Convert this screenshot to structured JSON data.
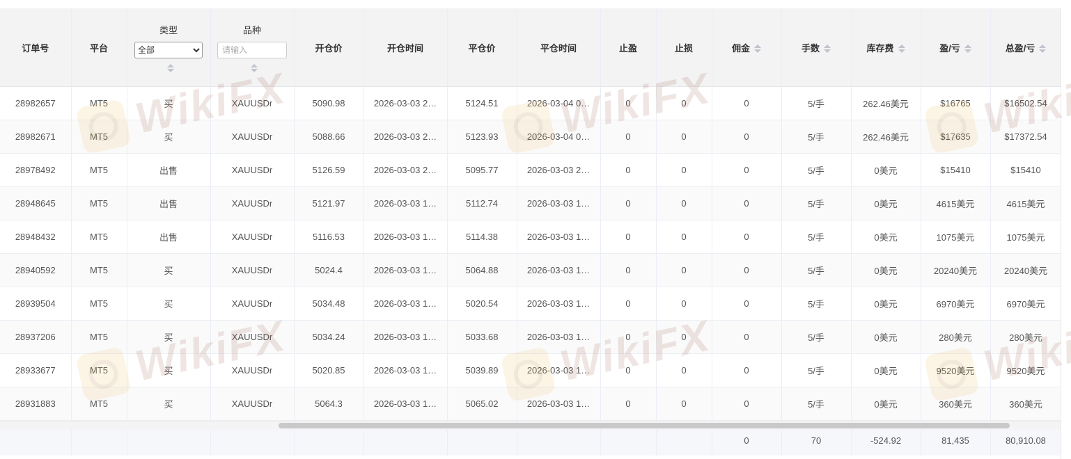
{
  "columns": {
    "order_no": "订单号",
    "platform": "平台",
    "type": "类型",
    "symbol": "品种",
    "open_price": "开仓价",
    "open_time": "开仓时间",
    "close_price": "平仓价",
    "close_time": "平仓时间",
    "take_profit": "止盈",
    "stop_loss": "止损",
    "commission": "佣金",
    "lots": "手数",
    "swap": "库存费",
    "pnl": "盈/亏",
    "total_pnl": "总盈/亏"
  },
  "filters": {
    "type_selected": "全部",
    "symbol_placeholder": "请输入"
  },
  "rows": [
    {
      "order": "28982657",
      "platform": "MT5",
      "type": "买",
      "symbol": "XAUUSDr",
      "open_price": "5090.98",
      "open_time": "2026-03-03 2…",
      "close_price": "5124.51",
      "close_time": "2026-03-04 0…",
      "tp": "0",
      "sl": "0",
      "commission": "0",
      "lots": "5/手",
      "swap": "262.46美元",
      "pnl": "$16765",
      "total": "$16502.54"
    },
    {
      "order": "28982671",
      "platform": "MT5",
      "type": "买",
      "symbol": "XAUUSDr",
      "open_price": "5088.66",
      "open_time": "2026-03-03 2…",
      "close_price": "5123.93",
      "close_time": "2026-03-04 0…",
      "tp": "0",
      "sl": "0",
      "commission": "0",
      "lots": "5/手",
      "swap": "262.46美元",
      "pnl": "$17635",
      "total": "$17372.54"
    },
    {
      "order": "28978492",
      "platform": "MT5",
      "type": "出售",
      "symbol": "XAUUSDr",
      "open_price": "5126.59",
      "open_time": "2026-03-03 2…",
      "close_price": "5095.77",
      "close_time": "2026-03-03 2…",
      "tp": "0",
      "sl": "0",
      "commission": "0",
      "lots": "5/手",
      "swap": "0美元",
      "pnl": "$15410",
      "total": "$15410"
    },
    {
      "order": "28948645",
      "platform": "MT5",
      "type": "出售",
      "symbol": "XAUUSDr",
      "open_price": "5121.97",
      "open_time": "2026-03-03 1…",
      "close_price": "5112.74",
      "close_time": "2026-03-03 1…",
      "tp": "0",
      "sl": "0",
      "commission": "0",
      "lots": "5/手",
      "swap": "0美元",
      "pnl": "4615美元",
      "total": "4615美元"
    },
    {
      "order": "28948432",
      "platform": "MT5",
      "type": "出售",
      "symbol": "XAUUSDr",
      "open_price": "5116.53",
      "open_time": "2026-03-03 1…",
      "close_price": "5114.38",
      "close_time": "2026-03-03 1…",
      "tp": "0",
      "sl": "0",
      "commission": "0",
      "lots": "5/手",
      "swap": "0美元",
      "pnl": "1075美元",
      "total": "1075美元"
    },
    {
      "order": "28940592",
      "platform": "MT5",
      "type": "买",
      "symbol": "XAUUSDr",
      "open_price": "5024.4",
      "open_time": "2026-03-03 1…",
      "close_price": "5064.88",
      "close_time": "2026-03-03 1…",
      "tp": "0",
      "sl": "0",
      "commission": "0",
      "lots": "5/手",
      "swap": "0美元",
      "pnl": "20240美元",
      "total": "20240美元"
    },
    {
      "order": "28939504",
      "platform": "MT5",
      "type": "买",
      "symbol": "XAUUSDr",
      "open_price": "5034.48",
      "open_time": "2026-03-03 1…",
      "close_price": "5020.54",
      "close_time": "2026-03-03 1…",
      "tp": "0",
      "sl": "0",
      "commission": "0",
      "lots": "5/手",
      "swap": "0美元",
      "pnl": "6970美元",
      "total": "6970美元"
    },
    {
      "order": "28937206",
      "platform": "MT5",
      "type": "买",
      "symbol": "XAUUSDr",
      "open_price": "5034.24",
      "open_time": "2026-03-03 1…",
      "close_price": "5033.68",
      "close_time": "2026-03-03 1…",
      "tp": "0",
      "sl": "0",
      "commission": "0",
      "lots": "5/手",
      "swap": "0美元",
      "pnl": "280美元",
      "total": "280美元"
    },
    {
      "order": "28933677",
      "platform": "MT5",
      "type": "买",
      "symbol": "XAUUSDr",
      "open_price": "5020.85",
      "open_time": "2026-03-03 1…",
      "close_price": "5039.89",
      "close_time": "2026-03-03 1…",
      "tp": "0",
      "sl": "0",
      "commission": "0",
      "lots": "5/手",
      "swap": "0美元",
      "pnl": "9520美元",
      "total": "9520美元"
    },
    {
      "order": "28931883",
      "platform": "MT5",
      "type": "买",
      "symbol": "XAUUSDr",
      "open_price": "5064.3",
      "open_time": "2026-03-03 1…",
      "close_price": "5065.02",
      "close_time": "2026-03-03 1…",
      "tp": "0",
      "sl": "0",
      "commission": "0",
      "lots": "5/手",
      "swap": "0美元",
      "pnl": "360美元",
      "total": "360美元"
    }
  ],
  "totals": {
    "commission": "0",
    "lots": "70",
    "swap": "-524.92",
    "pnl": "81,435",
    "total_pnl": "80,910.08"
  },
  "watermark": {
    "text": "WikiFX",
    "color": "#a36b5f",
    "logo_color": "#f0c36a"
  }
}
